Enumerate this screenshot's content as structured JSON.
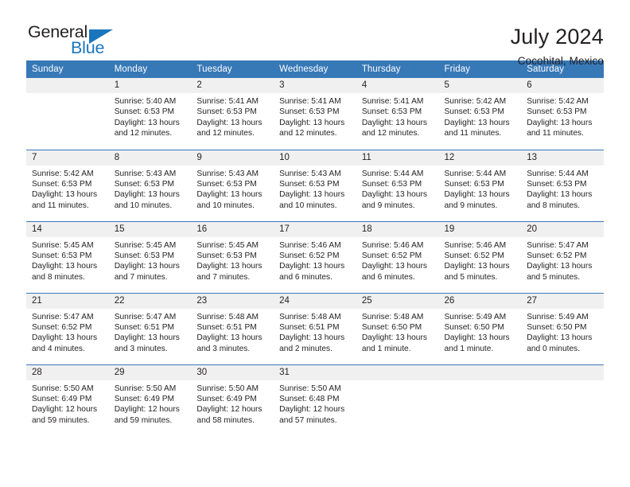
{
  "logo": {
    "word1": "General",
    "word2": "Blue",
    "accent_color": "#1b75bc",
    "triangle_icon": "logo-triangle-icon"
  },
  "header": {
    "title": "July 2024",
    "subtitle": "Cocohital, Mexico"
  },
  "theme": {
    "header_blue": "#3778b7",
    "daynum_bg": "#f0f0f0",
    "text": "#231f20"
  },
  "weekday_headers": [
    "Sunday",
    "Monday",
    "Tuesday",
    "Wednesday",
    "Thursday",
    "Friday",
    "Saturday"
  ],
  "weeks": [
    [
      {
        "day": "",
        "sunrise": "",
        "sunset": "",
        "daylight1": "",
        "daylight2": ""
      },
      {
        "day": "1",
        "sunrise": "Sunrise: 5:40 AM",
        "sunset": "Sunset: 6:53 PM",
        "daylight1": "Daylight: 13 hours",
        "daylight2": "and 12 minutes."
      },
      {
        "day": "2",
        "sunrise": "Sunrise: 5:41 AM",
        "sunset": "Sunset: 6:53 PM",
        "daylight1": "Daylight: 13 hours",
        "daylight2": "and 12 minutes."
      },
      {
        "day": "3",
        "sunrise": "Sunrise: 5:41 AM",
        "sunset": "Sunset: 6:53 PM",
        "daylight1": "Daylight: 13 hours",
        "daylight2": "and 12 minutes."
      },
      {
        "day": "4",
        "sunrise": "Sunrise: 5:41 AM",
        "sunset": "Sunset: 6:53 PM",
        "daylight1": "Daylight: 13 hours",
        "daylight2": "and 12 minutes."
      },
      {
        "day": "5",
        "sunrise": "Sunrise: 5:42 AM",
        "sunset": "Sunset: 6:53 PM",
        "daylight1": "Daylight: 13 hours",
        "daylight2": "and 11 minutes."
      },
      {
        "day": "6",
        "sunrise": "Sunrise: 5:42 AM",
        "sunset": "Sunset: 6:53 PM",
        "daylight1": "Daylight: 13 hours",
        "daylight2": "and 11 minutes."
      }
    ],
    [
      {
        "day": "7",
        "sunrise": "Sunrise: 5:42 AM",
        "sunset": "Sunset: 6:53 PM",
        "daylight1": "Daylight: 13 hours",
        "daylight2": "and 11 minutes."
      },
      {
        "day": "8",
        "sunrise": "Sunrise: 5:43 AM",
        "sunset": "Sunset: 6:53 PM",
        "daylight1": "Daylight: 13 hours",
        "daylight2": "and 10 minutes."
      },
      {
        "day": "9",
        "sunrise": "Sunrise: 5:43 AM",
        "sunset": "Sunset: 6:53 PM",
        "daylight1": "Daylight: 13 hours",
        "daylight2": "and 10 minutes."
      },
      {
        "day": "10",
        "sunrise": "Sunrise: 5:43 AM",
        "sunset": "Sunset: 6:53 PM",
        "daylight1": "Daylight: 13 hours",
        "daylight2": "and 10 minutes."
      },
      {
        "day": "11",
        "sunrise": "Sunrise: 5:44 AM",
        "sunset": "Sunset: 6:53 PM",
        "daylight1": "Daylight: 13 hours",
        "daylight2": "and 9 minutes."
      },
      {
        "day": "12",
        "sunrise": "Sunrise: 5:44 AM",
        "sunset": "Sunset: 6:53 PM",
        "daylight1": "Daylight: 13 hours",
        "daylight2": "and 9 minutes."
      },
      {
        "day": "13",
        "sunrise": "Sunrise: 5:44 AM",
        "sunset": "Sunset: 6:53 PM",
        "daylight1": "Daylight: 13 hours",
        "daylight2": "and 8 minutes."
      }
    ],
    [
      {
        "day": "14",
        "sunrise": "Sunrise: 5:45 AM",
        "sunset": "Sunset: 6:53 PM",
        "daylight1": "Daylight: 13 hours",
        "daylight2": "and 8 minutes."
      },
      {
        "day": "15",
        "sunrise": "Sunrise: 5:45 AM",
        "sunset": "Sunset: 6:53 PM",
        "daylight1": "Daylight: 13 hours",
        "daylight2": "and 7 minutes."
      },
      {
        "day": "16",
        "sunrise": "Sunrise: 5:45 AM",
        "sunset": "Sunset: 6:53 PM",
        "daylight1": "Daylight: 13 hours",
        "daylight2": "and 7 minutes."
      },
      {
        "day": "17",
        "sunrise": "Sunrise: 5:46 AM",
        "sunset": "Sunset: 6:52 PM",
        "daylight1": "Daylight: 13 hours",
        "daylight2": "and 6 minutes."
      },
      {
        "day": "18",
        "sunrise": "Sunrise: 5:46 AM",
        "sunset": "Sunset: 6:52 PM",
        "daylight1": "Daylight: 13 hours",
        "daylight2": "and 6 minutes."
      },
      {
        "day": "19",
        "sunrise": "Sunrise: 5:46 AM",
        "sunset": "Sunset: 6:52 PM",
        "daylight1": "Daylight: 13 hours",
        "daylight2": "and 5 minutes."
      },
      {
        "day": "20",
        "sunrise": "Sunrise: 5:47 AM",
        "sunset": "Sunset: 6:52 PM",
        "daylight1": "Daylight: 13 hours",
        "daylight2": "and 5 minutes."
      }
    ],
    [
      {
        "day": "21",
        "sunrise": "Sunrise: 5:47 AM",
        "sunset": "Sunset: 6:52 PM",
        "daylight1": "Daylight: 13 hours",
        "daylight2": "and 4 minutes."
      },
      {
        "day": "22",
        "sunrise": "Sunrise: 5:47 AM",
        "sunset": "Sunset: 6:51 PM",
        "daylight1": "Daylight: 13 hours",
        "daylight2": "and 3 minutes."
      },
      {
        "day": "23",
        "sunrise": "Sunrise: 5:48 AM",
        "sunset": "Sunset: 6:51 PM",
        "daylight1": "Daylight: 13 hours",
        "daylight2": "and 3 minutes."
      },
      {
        "day": "24",
        "sunrise": "Sunrise: 5:48 AM",
        "sunset": "Sunset: 6:51 PM",
        "daylight1": "Daylight: 13 hours",
        "daylight2": "and 2 minutes."
      },
      {
        "day": "25",
        "sunrise": "Sunrise: 5:48 AM",
        "sunset": "Sunset: 6:50 PM",
        "daylight1": "Daylight: 13 hours",
        "daylight2": "and 1 minute."
      },
      {
        "day": "26",
        "sunrise": "Sunrise: 5:49 AM",
        "sunset": "Sunset: 6:50 PM",
        "daylight1": "Daylight: 13 hours",
        "daylight2": "and 1 minute."
      },
      {
        "day": "27",
        "sunrise": "Sunrise: 5:49 AM",
        "sunset": "Sunset: 6:50 PM",
        "daylight1": "Daylight: 13 hours",
        "daylight2": "and 0 minutes."
      }
    ],
    [
      {
        "day": "28",
        "sunrise": "Sunrise: 5:50 AM",
        "sunset": "Sunset: 6:49 PM",
        "daylight1": "Daylight: 12 hours",
        "daylight2": "and 59 minutes."
      },
      {
        "day": "29",
        "sunrise": "Sunrise: 5:50 AM",
        "sunset": "Sunset: 6:49 PM",
        "daylight1": "Daylight: 12 hours",
        "daylight2": "and 59 minutes."
      },
      {
        "day": "30",
        "sunrise": "Sunrise: 5:50 AM",
        "sunset": "Sunset: 6:49 PM",
        "daylight1": "Daylight: 12 hours",
        "daylight2": "and 58 minutes."
      },
      {
        "day": "31",
        "sunrise": "Sunrise: 5:50 AM",
        "sunset": "Sunset: 6:48 PM",
        "daylight1": "Daylight: 12 hours",
        "daylight2": "and 57 minutes."
      },
      {
        "day": "",
        "sunrise": "",
        "sunset": "",
        "daylight1": "",
        "daylight2": ""
      },
      {
        "day": "",
        "sunrise": "",
        "sunset": "",
        "daylight1": "",
        "daylight2": ""
      },
      {
        "day": "",
        "sunrise": "",
        "sunset": "",
        "daylight1": "",
        "daylight2": ""
      }
    ]
  ]
}
